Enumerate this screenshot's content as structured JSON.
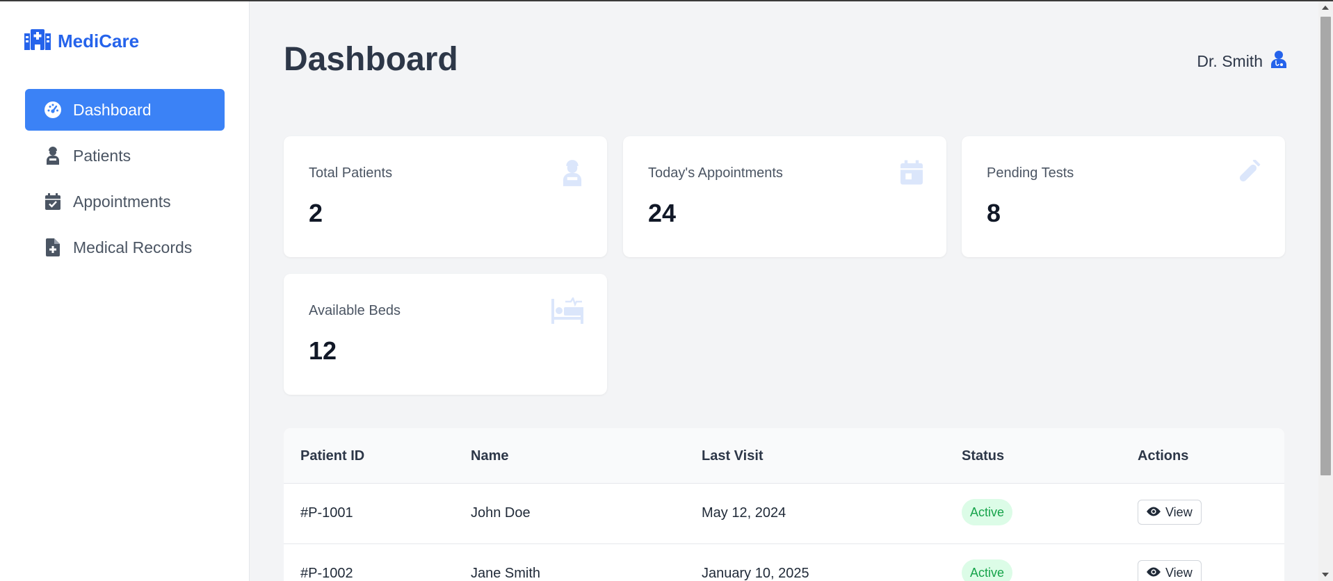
{
  "app": {
    "name": "MediCare",
    "brand_color": "#2563eb"
  },
  "sidebar": {
    "items": [
      {
        "label": "Dashboard",
        "icon": "gauge-icon",
        "active": true
      },
      {
        "label": "Patients",
        "icon": "user-injured-icon",
        "active": false
      },
      {
        "label": "Appointments",
        "icon": "calendar-check-icon",
        "active": false
      },
      {
        "label": "Medical Records",
        "icon": "file-medical-icon",
        "active": false
      }
    ]
  },
  "header": {
    "title": "Dashboard",
    "user_name": "Dr. Smith",
    "user_icon": "user-doctor-icon"
  },
  "stats": [
    {
      "label": "Total Patients",
      "value": "2",
      "icon": "user-injured-icon"
    },
    {
      "label": "Today's Appointments",
      "value": "24",
      "icon": "calendar-icon"
    },
    {
      "label": "Pending Tests",
      "value": "8",
      "icon": "syringe-icon"
    },
    {
      "label": "Available Beds",
      "value": "12",
      "icon": "bed-icon"
    }
  ],
  "table": {
    "headers": [
      "Patient ID",
      "Name",
      "Last Visit",
      "Status",
      "Actions"
    ],
    "rows": [
      {
        "id": "#P-1001",
        "name": "John Doe",
        "last_visit": "May 12, 2024",
        "status": "Active",
        "action": "View"
      },
      {
        "id": "#P-1002",
        "name": "Jane Smith",
        "last_visit": "January 10, 2025",
        "status": "Active",
        "action": "View"
      }
    ]
  },
  "colors": {
    "accent": "#3b82f6",
    "status_active_bg": "#dcfce7",
    "status_active_text": "#16a34a",
    "icon_faded": "#dbe6fb"
  }
}
